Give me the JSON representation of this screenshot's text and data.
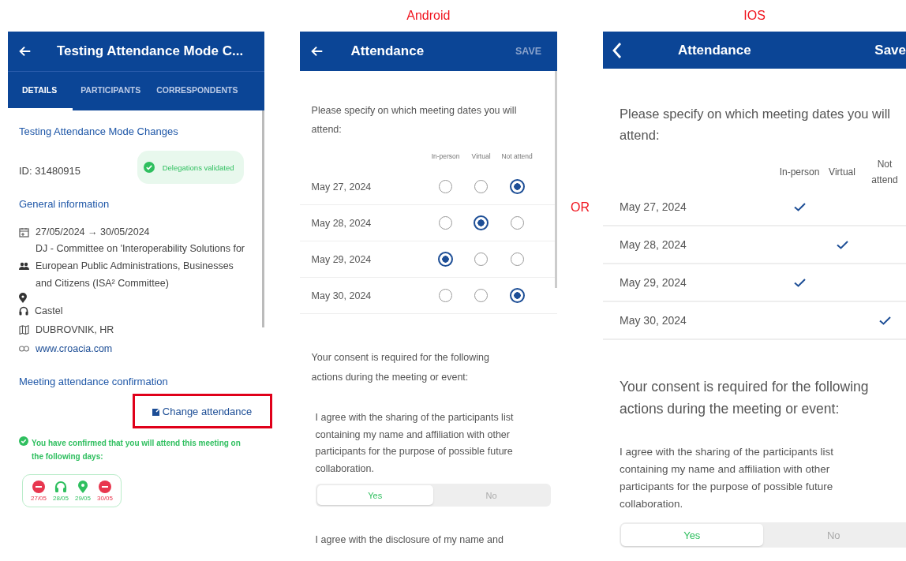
{
  "left_screen": {
    "title": "Testing Attendance Mode C...",
    "tabs": [
      {
        "label": "DETAILS",
        "selected": true
      },
      {
        "label": "PARTICIPANTS",
        "selected": false
      },
      {
        "label": "CORRESPONDENTS",
        "selected": false
      }
    ],
    "event_title": "Testing Attendance Mode Changes",
    "id": "ID: 31480915",
    "badge": "Delegations validated",
    "general_heading": "General information",
    "info": [
      {
        "kind": "dates",
        "text": "27/05/2024 → 30/05/2024"
      },
      {
        "kind": "group",
        "text": "DJ - Committee on 'Interoperability Solutions for European Public Administrations, Businesses and Citizens (ISA² Committee)"
      },
      {
        "kind": "location"
      },
      {
        "kind": "virtual",
        "text": "Castel"
      },
      {
        "kind": "city",
        "text": "DUBROVNIK, HR"
      },
      {
        "kind": "link",
        "text": "www.croacia.com"
      }
    ],
    "confirmation_heading": "Meeting attendance confirmation",
    "change_button": {
      "label": "Change attendance",
      "highlighted": true
    },
    "confirmed_message": "You have confirmed that you will attend this meeting on the following days:",
    "days": [
      {
        "date": "27/05",
        "kind": "absent"
      },
      {
        "date": "28/05",
        "kind": "virtual"
      },
      {
        "date": "29/05",
        "kind": "onsite"
      },
      {
        "date": "30/05",
        "kind": "absent"
      }
    ]
  },
  "android_label": "Android",
  "android_screen": {
    "title": "Attendance",
    "save": {
      "label": "SAVE",
      "disabled": true
    },
    "intro": "Please specify on which meeting dates you will attend:",
    "columns": [
      "In-person",
      "Virtual",
      "Not attend"
    ],
    "rows": [
      {
        "date": "May 27, 2024",
        "options": [
          {
            "selected": false
          },
          {
            "selected": false
          },
          {
            "selected": true
          }
        ]
      },
      {
        "date": "May 28, 2024",
        "options": [
          {
            "selected": false
          },
          {
            "selected": true
          },
          {
            "selected": false
          }
        ]
      },
      {
        "date": "May 29, 2024",
        "options": [
          {
            "selected": true
          },
          {
            "selected": false
          },
          {
            "selected": false
          }
        ]
      },
      {
        "date": "May 30, 2024",
        "options": [
          {
            "selected": false
          },
          {
            "selected": false
          },
          {
            "selected": true
          }
        ]
      }
    ],
    "consent_intro": "Your consent is required for the following actions during the meeting or event:",
    "consents": [
      {
        "text": "I agree with the sharing of the participants list containing my name and affiliation with other participants for the purpose of possible future collaboration.",
        "options": [
          {
            "label": "Yes",
            "selected": true
          },
          {
            "label": "No",
            "selected": false
          }
        ]
      }
    ],
    "next_consent": "I agree with the disclosure of my name and"
  },
  "or_label": "OR",
  "ios_label": "IOS",
  "ios_screen": {
    "title": "Attendance",
    "save": {
      "label": "Save",
      "disabled": false
    },
    "intro": "Please specify on which meeting dates you will attend:",
    "columns": [
      "In-person",
      "Virtual",
      "Not attend"
    ],
    "rows": [
      {
        "date": "May 27, 2024",
        "options": [
          {
            "selected": true
          },
          {
            "selected": false
          },
          {
            "selected": false
          }
        ]
      },
      {
        "date": "May 28, 2024",
        "options": [
          {
            "selected": false
          },
          {
            "selected": true
          },
          {
            "selected": false
          }
        ]
      },
      {
        "date": "May 29, 2024",
        "options": [
          {
            "selected": true
          },
          {
            "selected": false
          },
          {
            "selected": false
          }
        ]
      },
      {
        "date": "May 30, 2024",
        "options": [
          {
            "selected": false
          },
          {
            "selected": false
          },
          {
            "selected": true
          }
        ]
      }
    ],
    "consent_intro": "Your consent is required for the following actions during the meeting or event:",
    "consents": [
      {
        "text": "I agree with the sharing of the participants list containing my name and affiliation with other participants for the purpose of possible future collaboration.",
        "options": [
          {
            "label": "Yes",
            "selected": true
          },
          {
            "label": "No",
            "selected": false
          }
        ]
      }
    ]
  }
}
